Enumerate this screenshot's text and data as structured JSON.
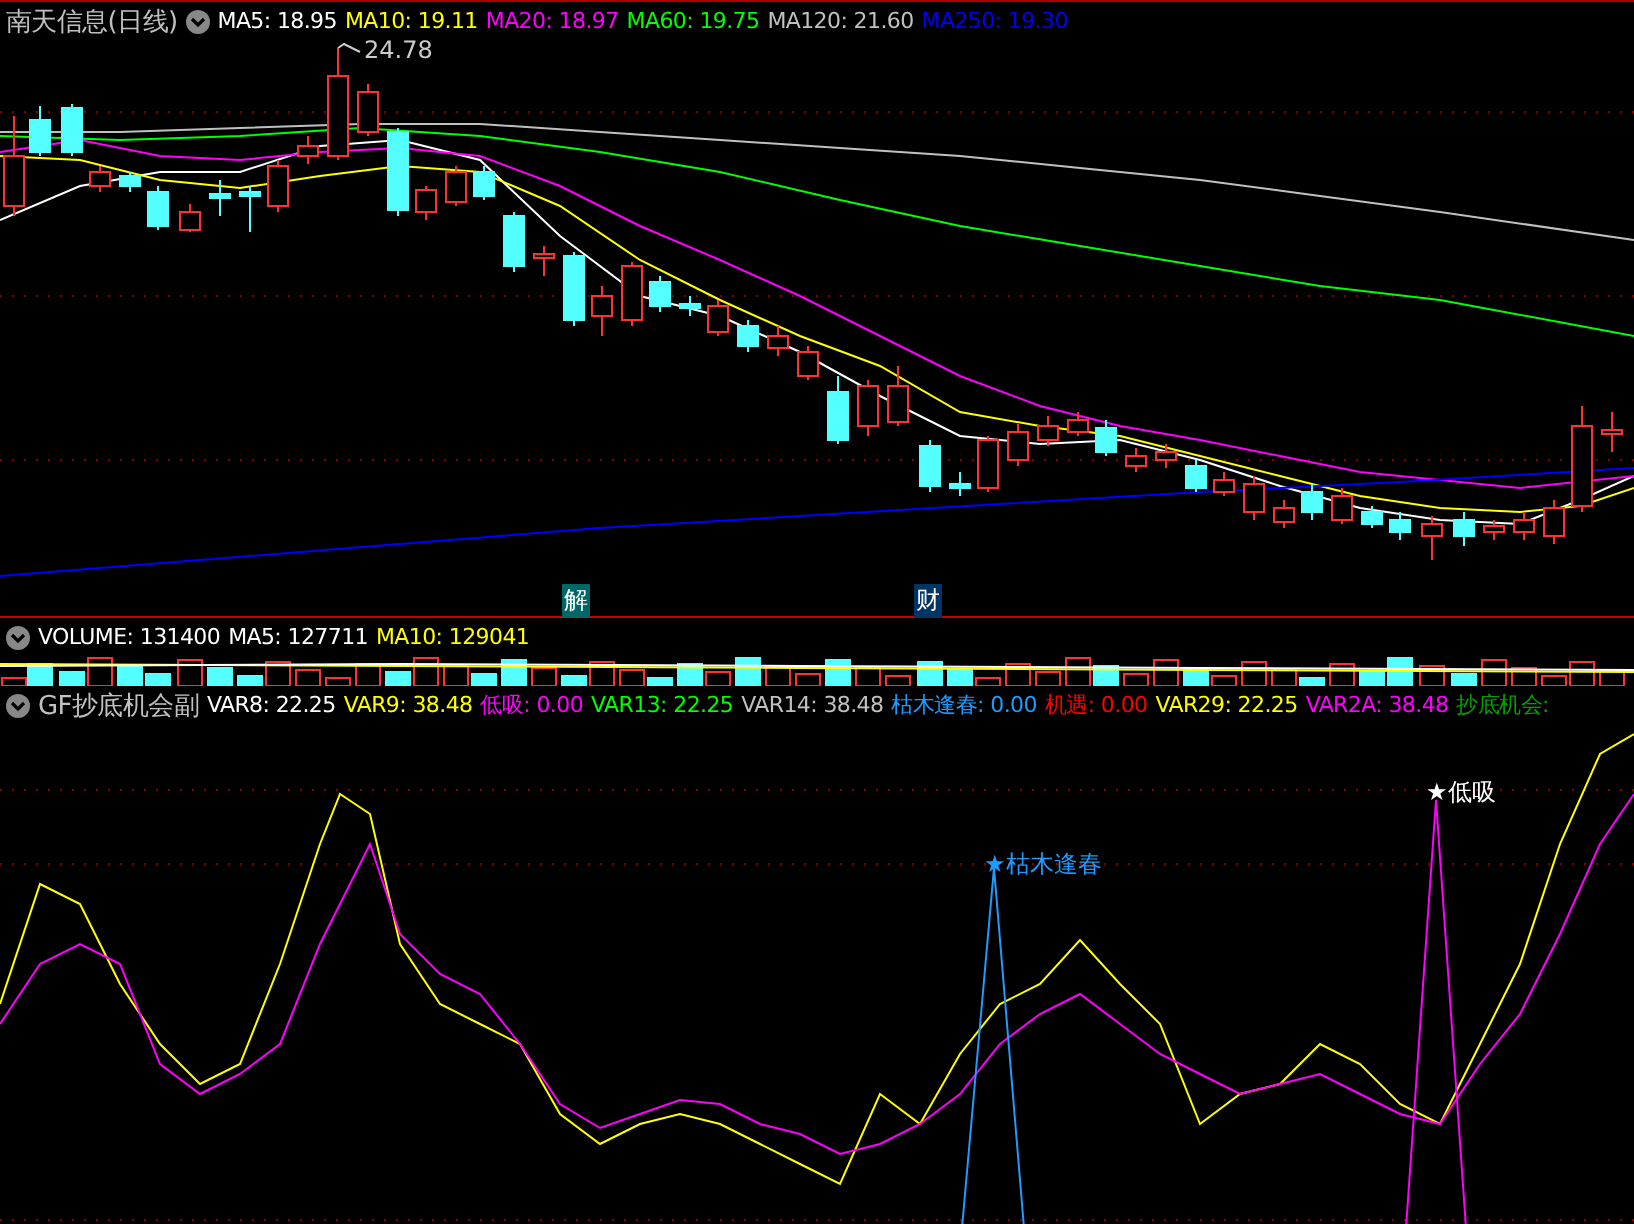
{
  "price_panel": {
    "title": "南天信息(日线)",
    "legend": [
      {
        "text": "MA5: 18.95",
        "color": "#ffffff"
      },
      {
        "text": "MA10: 19.11",
        "color": "#ffff00"
      },
      {
        "text": "MA20: 18.97",
        "color": "#ff00ff"
      },
      {
        "text": "MA60: 19.75",
        "color": "#00ff00"
      },
      {
        "text": "MA120: 21.60",
        "color": "#c0c0c0"
      },
      {
        "text": "MA250: 19.30",
        "color": "#0000ff"
      }
    ],
    "high_label": "24.78",
    "event_markers": [
      "解",
      "财"
    ]
  },
  "volume_panel": {
    "legend": [
      {
        "text": "VOLUME: 131400",
        "color": "#ffffff"
      },
      {
        "text": "MA5: 127711",
        "color": "#ffffff"
      },
      {
        "text": "MA10: 129041",
        "color": "#ffff00"
      }
    ]
  },
  "indicator_panel": {
    "title": "GF抄底机会副",
    "legend": [
      {
        "text": "VAR8: 22.25",
        "color": "#ffffff"
      },
      {
        "text": "VAR9: 38.48",
        "color": "#ffff00"
      },
      {
        "text": "低吸: 0.00",
        "color": "#ff00ff"
      },
      {
        "text": "VAR13: 22.25",
        "color": "#00ff00"
      },
      {
        "text": "VAR14: 38.48",
        "color": "#c0c0c0"
      },
      {
        "text": "枯木逢春: 0.00",
        "color": "#1e9bff"
      },
      {
        "text": "机遇: 0.00",
        "color": "#ff0000"
      },
      {
        "text": "VAR29: 22.25",
        "color": "#ffff00"
      },
      {
        "text": "VAR2A: 38.48",
        "color": "#ff00ff"
      },
      {
        "text": "抄底机会:",
        "color": "#00a000"
      }
    ],
    "signals": [
      "★枯木逢春",
      "★低吸"
    ]
  }
}
